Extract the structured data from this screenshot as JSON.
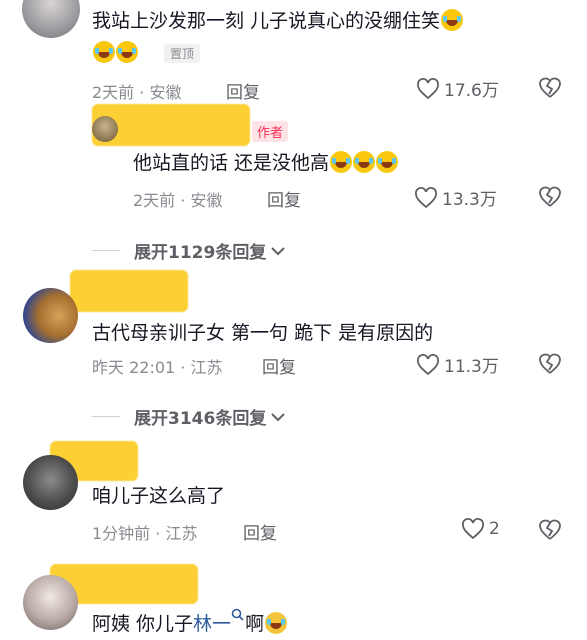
{
  "comments": [
    {
      "text": "我站上沙发那一刻 儿子说真心的没绷住笑",
      "pinned_label": "置顶",
      "meta": "2天前 · 安徽",
      "reply_label": "回复",
      "likes": "17.6万"
    },
    {
      "author_badge": "作者",
      "text": "他站直的话 还是没他高",
      "meta": "2天前 · 安徽",
      "reply_label": "回复",
      "likes": "13.3万"
    },
    {
      "expand_label": "展开1129条回复"
    },
    {
      "text": "古代母亲训子女 第一句 跪下 是有原因的",
      "meta": "昨天 22:01 · 江苏",
      "reply_label": "回复",
      "likes": "11.3万"
    },
    {
      "expand_label": "展开3146条回复"
    },
    {
      "text": "咱儿子这么高了",
      "meta": "1分钟前 · 江苏",
      "reply_label": "回复",
      "likes": "2"
    },
    {
      "text_prefix": "阿姨  你儿子",
      "mention": "林一",
      "text_suffix": "啊"
    }
  ],
  "colors": {
    "redaction": "#fcd034",
    "author_red": "#fe2c55",
    "mention_blue": "#2f5b9c"
  },
  "icons": [
    "heart-icon",
    "broken-heart-icon",
    "chevron-down-icon",
    "search-icon",
    "crying-laugh-emoji"
  ]
}
